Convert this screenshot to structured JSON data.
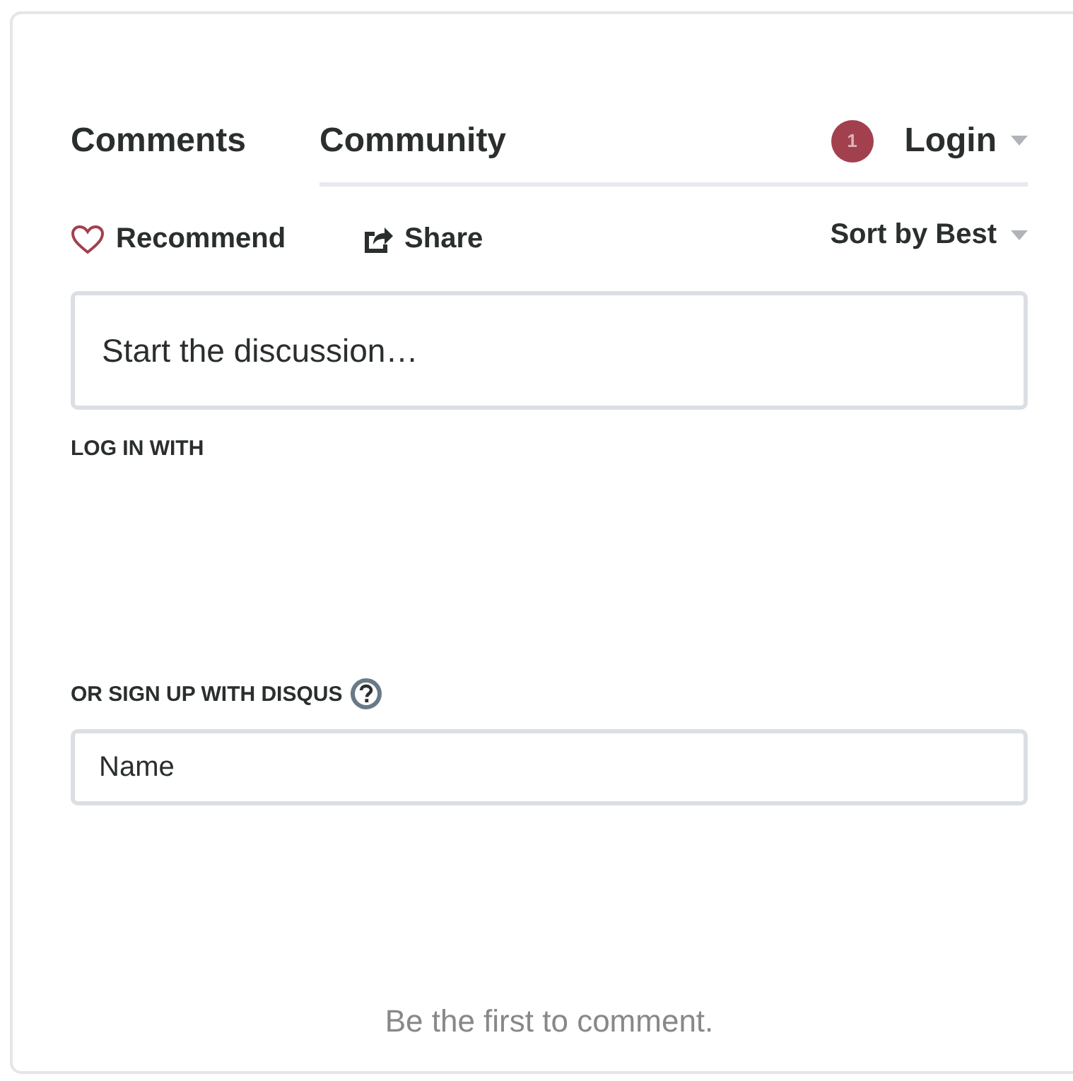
{
  "tabs": [
    {
      "label": "Comments",
      "selected": true
    },
    {
      "label": "Community",
      "selected": false
    }
  ],
  "notification_badge": "1",
  "login": {
    "label": "Login"
  },
  "actions": [
    {
      "kind": "recommend",
      "label": "Recommend"
    },
    {
      "kind": "share",
      "label": "Share"
    }
  ],
  "sort": {
    "label": "Sort by Best"
  },
  "comment_box": {
    "placeholder": "Start the discussion…"
  },
  "login_with_heading": "LOG IN WITH",
  "signup_heading": "OR SIGN UP WITH DISQUS",
  "name_field": {
    "placeholder": "Name"
  },
  "empty_message": "Be the first to comment."
}
